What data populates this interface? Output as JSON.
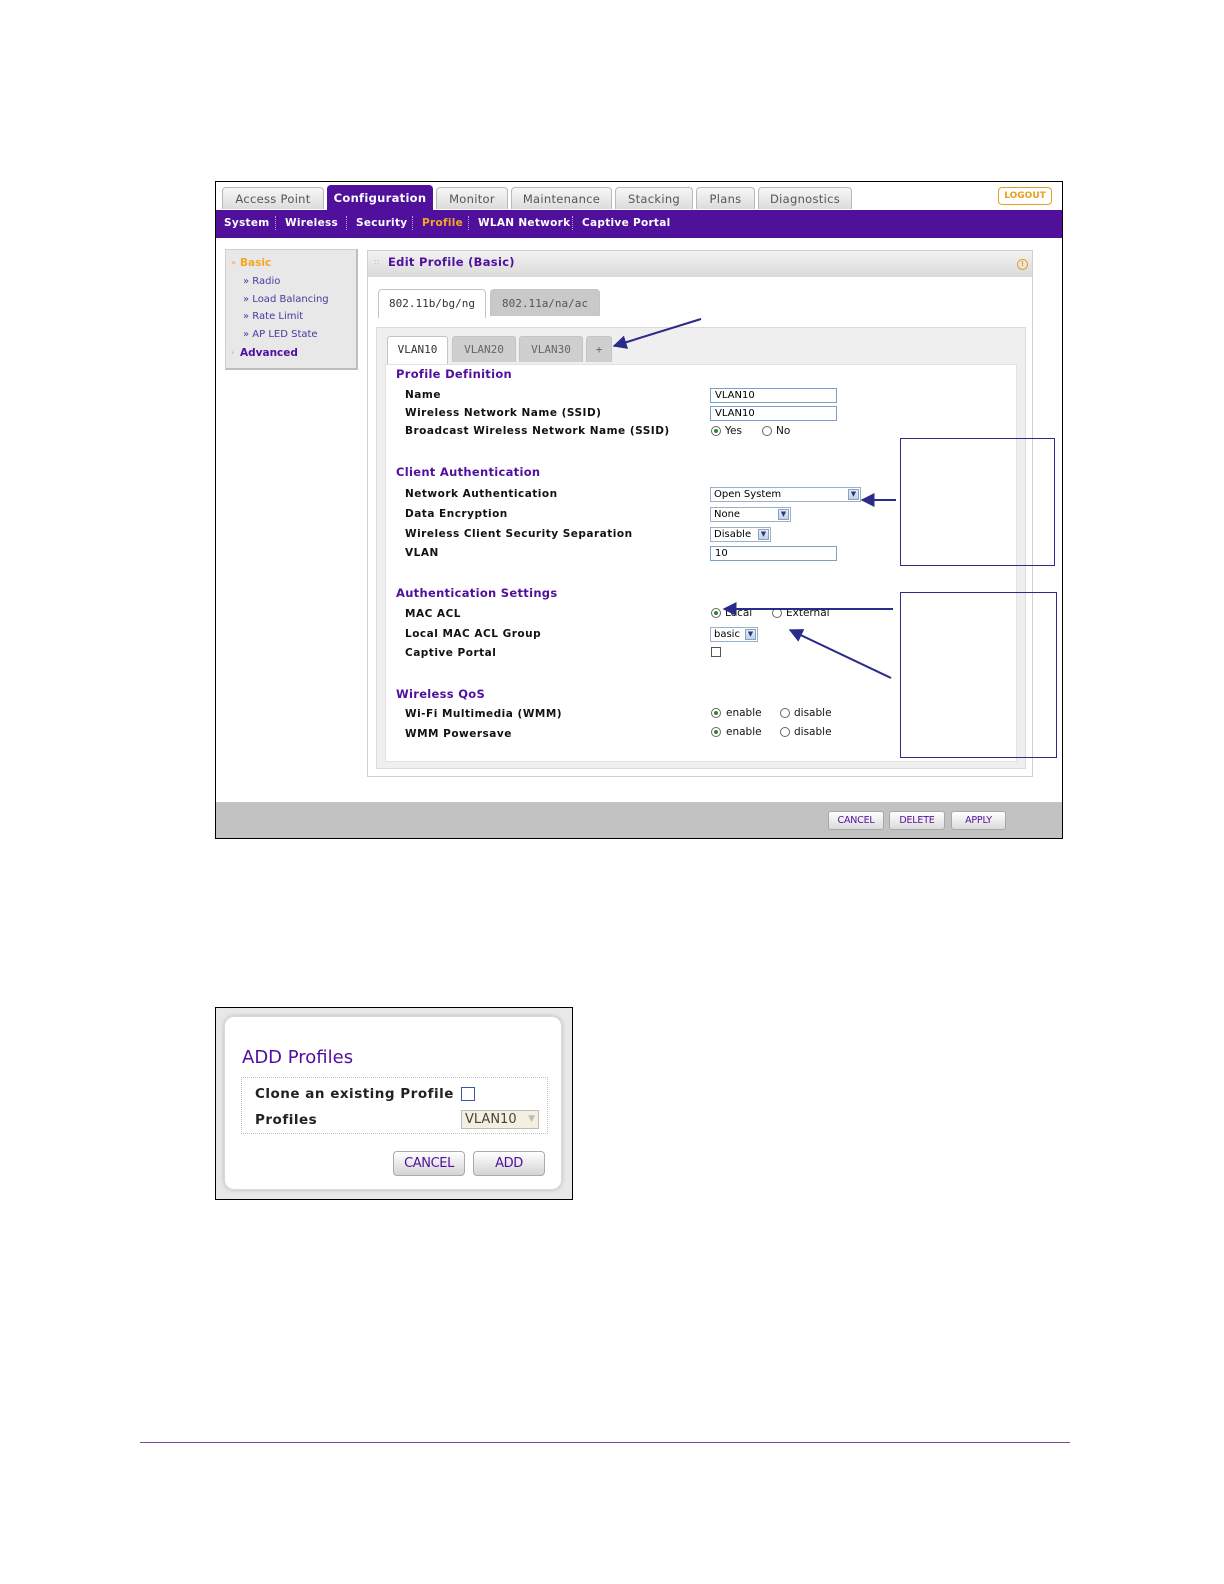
{
  "top_tabs": [
    {
      "label": "Access Point"
    },
    {
      "label": "Configuration",
      "active": true
    },
    {
      "label": "Monitor"
    },
    {
      "label": "Maintenance"
    },
    {
      "label": "Stacking"
    },
    {
      "label": "Plans"
    },
    {
      "label": "Diagnostics"
    }
  ],
  "logout_label": "LOGOUT",
  "sub_nav": [
    {
      "label": "System"
    },
    {
      "label": "Wireless"
    },
    {
      "label": "Security"
    },
    {
      "label": "Profile",
      "active": true
    },
    {
      "label": "WLAN Network"
    },
    {
      "label": "Captive Portal"
    }
  ],
  "left_menu": {
    "basic": "Basic",
    "items": [
      "» Radio",
      "» Load Balancing",
      "» Rate Limit",
      "» AP LED State"
    ],
    "advanced": "Advanced"
  },
  "panel": {
    "title": "Edit Profile (Basic)",
    "info_icon": "!",
    "band_tabs": [
      "802.11b/bg/ng",
      "802.11a/na/ac"
    ],
    "vlan_tabs": [
      "VLAN10",
      "VLAN20",
      "VLAN30",
      "+"
    ]
  },
  "profile_definition": {
    "heading": "Profile Definition",
    "name_label": "Name",
    "name_value": "VLAN10",
    "ssid_label": "Wireless Network Name (SSID)",
    "ssid_value": "VLAN10",
    "broadcast_label": "Broadcast Wireless Network Name (SSID)",
    "yes_label": "Yes",
    "no_label": "No"
  },
  "client_auth": {
    "heading": "Client Authentication",
    "net_auth_label": "Network Authentication",
    "net_auth_value": "Open System",
    "encryption_label": "Data Encryption",
    "encryption_value": "None",
    "separation_label": "Wireless Client Security Separation",
    "separation_value": "Disable",
    "vlan_label": "VLAN",
    "vlan_value": "10"
  },
  "auth_settings": {
    "heading": "Authentication Settings",
    "mac_acl_label": "MAC ACL",
    "local_label": "Local",
    "external_label": "External",
    "group_label": "Local MAC ACL Group",
    "group_value": "basic",
    "captive_label": "Captive Portal"
  },
  "qos": {
    "heading": "Wireless QoS",
    "wmm_label": "Wi-Fi Multimedia (WMM)",
    "powersave_label": "WMM Powersave",
    "enable_label": "enable",
    "disable_label": "disable"
  },
  "footer_buttons": {
    "cancel": "CANCEL",
    "delete": "DELETE",
    "apply": "APPLY"
  },
  "dialog": {
    "title": "ADD Profiles",
    "clone_label": "Clone an existing Profile",
    "profiles_label": "Profiles",
    "profiles_value": "VLAN10",
    "cancel": "CANCEL",
    "add": "ADD"
  },
  "colors": {
    "brand_purple": "#51109c",
    "accent_orange": "#f5a623",
    "annotation_blue": "#2b2b8a"
  }
}
